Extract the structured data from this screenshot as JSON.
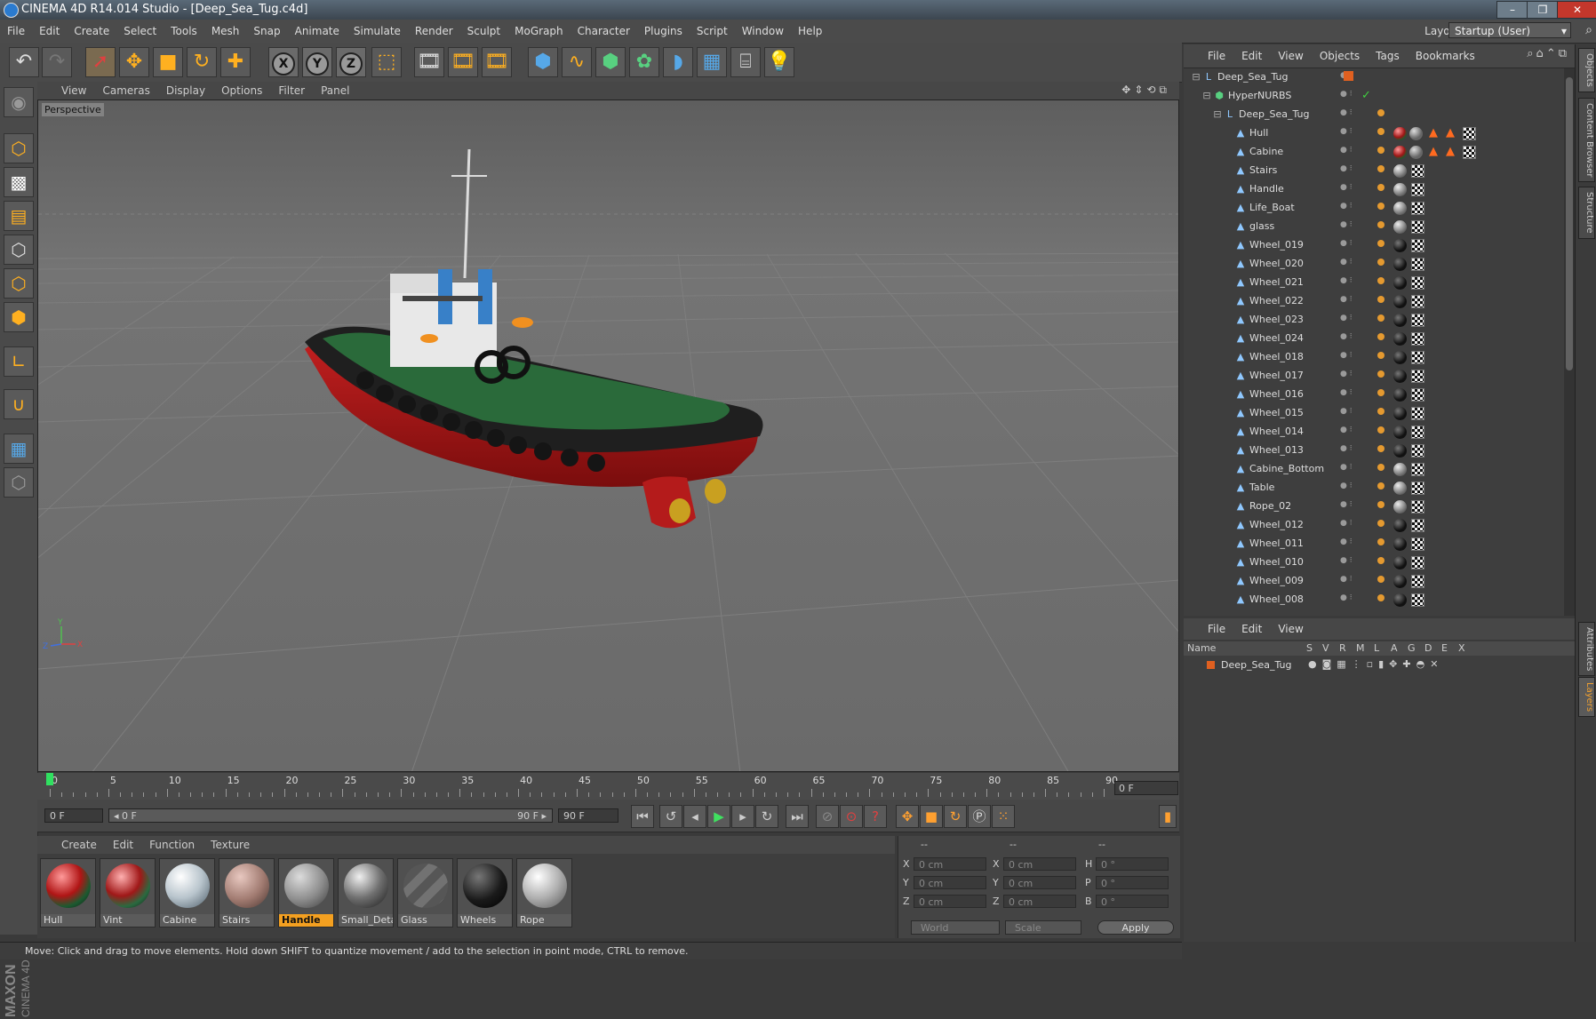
{
  "window": {
    "title": "CINEMA 4D R14.014 Studio - [Deep_Sea_Tug.c4d]",
    "buttons": [
      "–",
      "❐",
      "✕"
    ]
  },
  "menubar": {
    "items": [
      "File",
      "Edit",
      "Create",
      "Select",
      "Tools",
      "Mesh",
      "Snap",
      "Animate",
      "Simulate",
      "Render",
      "Sculpt",
      "MoGraph",
      "Character",
      "Plugins",
      "Script",
      "Window",
      "Help"
    ],
    "layout_label": "Layout:",
    "layout_value": "Startup (User)"
  },
  "toolbar": {
    "undo": "undo-icon",
    "redo": "redo-icon",
    "tools": [
      "live-selection",
      "move",
      "scale",
      "rotate",
      "add"
    ],
    "axes": [
      "X",
      "Y",
      "Z"
    ],
    "coordinate": "world-coordinate-icon",
    "render": [
      "render-view",
      "render-to-picture-viewer",
      "edit-render-settings"
    ],
    "create": [
      "cube",
      "spline",
      "nurbs",
      "array",
      "deformer",
      "floor",
      "camera",
      "light"
    ]
  },
  "viewport": {
    "menu": [
      "View",
      "Cameras",
      "Display",
      "Options",
      "Filter",
      "Panel"
    ],
    "label": "Perspective",
    "colors": {
      "background": "#6b6b6b",
      "grid": "#808080",
      "hull_red": "#b41b1b",
      "deck_green": "#2a6a3a",
      "rubber": "#222222"
    }
  },
  "timeline": {
    "ticks": [
      "0",
      "5",
      "10",
      "15",
      "20",
      "25",
      "30",
      "35",
      "40",
      "45",
      "50",
      "55",
      "60",
      "65",
      "70",
      "75",
      "80",
      "85",
      "90"
    ],
    "current_frame": 0,
    "end_field": "0 F"
  },
  "playbar": {
    "start_field": "0 F",
    "range_start": "◂ 0 F",
    "range_end": "90 F ▸",
    "end_field": "90 F"
  },
  "materials": {
    "menu": [
      "Create",
      "Edit",
      "Function",
      "Texture"
    ],
    "items": [
      {
        "label": "Hull",
        "selected": false
      },
      {
        "label": "Vint",
        "selected": false
      },
      {
        "label": "Cabine",
        "selected": false
      },
      {
        "label": "Stairs",
        "selected": false
      },
      {
        "label": "Handle",
        "selected": true
      },
      {
        "label": "Small_Deta",
        "selected": false
      },
      {
        "label": "Glass",
        "selected": false
      },
      {
        "label": "Wheels",
        "selected": false
      },
      {
        "label": "Rope",
        "selected": false
      }
    ]
  },
  "coords": {
    "headers": [
      "--",
      "--",
      "--"
    ],
    "rows": [
      {
        "a": "X",
        "av": "0 cm",
        "b": "X",
        "bv": "0 cm",
        "c": "H",
        "cv": "0 °"
      },
      {
        "a": "Y",
        "av": "0 cm",
        "b": "Y",
        "bv": "0 cm",
        "c": "P",
        "cv": "0 °"
      },
      {
        "a": "Z",
        "av": "0 cm",
        "b": "Z",
        "bv": "0 cm",
        "c": "B",
        "cv": "0 °"
      }
    ],
    "mode": "World",
    "transform": "Scale",
    "apply": "Apply"
  },
  "status": "Move: Click and drag to move elements. Hold down SHIFT to quantize movement / add to the selection in point mode, CTRL to remove.",
  "object_manager": {
    "menu": [
      "File",
      "Edit",
      "View",
      "Objects",
      "Tags",
      "Bookmarks"
    ],
    "objects": [
      {
        "name": "Deep_Sea_Tug",
        "level": 0,
        "kind": "null"
      },
      {
        "name": "HyperNURBS",
        "level": 1,
        "kind": "nurbs"
      },
      {
        "name": "Deep_Sea_Tug",
        "level": 2,
        "kind": "null"
      },
      {
        "name": "Hull",
        "level": 3,
        "kind": "poly",
        "tags": "hull"
      },
      {
        "name": "Cabine",
        "level": 3,
        "kind": "poly",
        "tags": "cabine"
      },
      {
        "name": "Stairs",
        "level": 3,
        "kind": "poly"
      },
      {
        "name": "Handle",
        "level": 3,
        "kind": "poly"
      },
      {
        "name": "Life_Boat",
        "level": 3,
        "kind": "poly"
      },
      {
        "name": "glass",
        "level": 3,
        "kind": "poly"
      },
      {
        "name": "Wheel_019",
        "level": 3,
        "kind": "poly"
      },
      {
        "name": "Wheel_020",
        "level": 3,
        "kind": "poly"
      },
      {
        "name": "Wheel_021",
        "level": 3,
        "kind": "poly"
      },
      {
        "name": "Wheel_022",
        "level": 3,
        "kind": "poly"
      },
      {
        "name": "Wheel_023",
        "level": 3,
        "kind": "poly"
      },
      {
        "name": "Wheel_024",
        "level": 3,
        "kind": "poly"
      },
      {
        "name": "Wheel_018",
        "level": 3,
        "kind": "poly"
      },
      {
        "name": "Wheel_017",
        "level": 3,
        "kind": "poly"
      },
      {
        "name": "Wheel_016",
        "level": 3,
        "kind": "poly"
      },
      {
        "name": "Wheel_015",
        "level": 3,
        "kind": "poly"
      },
      {
        "name": "Wheel_014",
        "level": 3,
        "kind": "poly"
      },
      {
        "name": "Wheel_013",
        "level": 3,
        "kind": "poly"
      },
      {
        "name": "Cabine_Bottom",
        "level": 3,
        "kind": "poly"
      },
      {
        "name": "Table",
        "level": 3,
        "kind": "poly"
      },
      {
        "name": "Rope_02",
        "level": 3,
        "kind": "poly"
      },
      {
        "name": "Wheel_012",
        "level": 3,
        "kind": "poly"
      },
      {
        "name": "Wheel_011",
        "level": 3,
        "kind": "poly"
      },
      {
        "name": "Wheel_010",
        "level": 3,
        "kind": "poly"
      },
      {
        "name": "Wheel_009",
        "level": 3,
        "kind": "poly"
      },
      {
        "name": "Wheel_008",
        "level": 3,
        "kind": "poly"
      }
    ]
  },
  "side_tabs": [
    "Objects",
    "Content Browser",
    "Structure",
    "Attributes",
    "Layers"
  ],
  "layer_manager": {
    "menu": [
      "File",
      "Edit",
      "View"
    ],
    "columns": [
      "Name",
      "S",
      "V",
      "R",
      "M",
      "L",
      "A",
      "G",
      "D",
      "E",
      "X"
    ],
    "layers": [
      {
        "name": "Deep_Sea_Tug",
        "color": "#e06020"
      }
    ]
  }
}
